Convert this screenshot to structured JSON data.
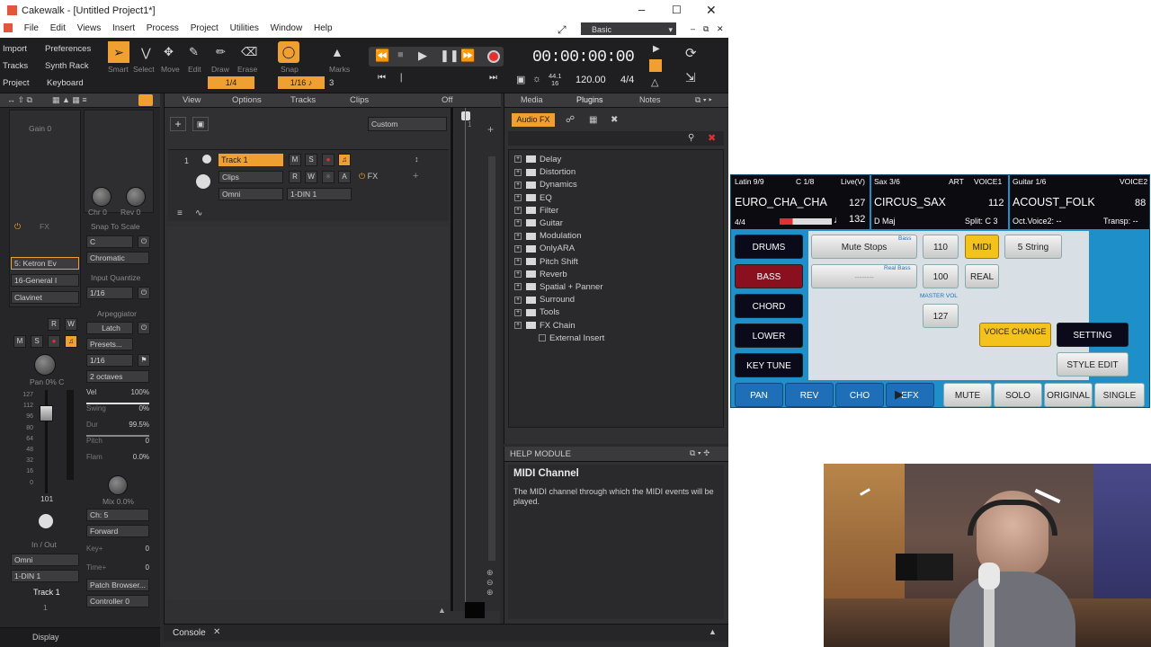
{
  "window": {
    "title": "Cakewalk - [Untitled Project1*]",
    "workspace": "Basic"
  },
  "menu": [
    "File",
    "Edit",
    "Views",
    "Insert",
    "Process",
    "Project",
    "Utilities",
    "Window",
    "Help"
  ],
  "quick": {
    "import": "Import",
    "preferences": "Preferences",
    "tracks": "Tracks",
    "synth_rack": "Synth Rack",
    "project": "Project",
    "keyboard": "Keyboard"
  },
  "tools": {
    "smart": "Smart",
    "select": "Select",
    "move": "Move",
    "edit": "Edit",
    "draw": "Draw",
    "erase": "Erase",
    "snap": "Snap",
    "marks": "Marks",
    "snap_value": "1/4",
    "grid_value": "1/16",
    "grid_num": "3"
  },
  "transport": {
    "time": "00:00:00:00",
    "sample_top": "44.1",
    "sample_bot": "16",
    "tempo": "120.00",
    "meter": "4/4"
  },
  "inspector": {
    "gain": "Gain",
    "gain_val": "0",
    "fx": "FX",
    "chr": "Chr",
    "chr_val": "0",
    "rev": "Rev",
    "rev_val": "0",
    "snap_to_scale": "Snap To Scale",
    "scale_root": "C",
    "scale_type": "Chromatic",
    "synth": "5: Ketron Ev",
    "program": "16-General I",
    "preset": "Clavinet",
    "input_quantize": "Input Quantize",
    "iq_val": "1/16",
    "arp": "Arpeggiator",
    "latch": "Latch",
    "presets": "Presets...",
    "arp_rate": "1/16",
    "octaves": "2 octaves",
    "vel": "Vel",
    "vel_val": "100%",
    "swing": "Swing",
    "swing_val": "0%",
    "dur": "Dur",
    "dur_val": "99.5%",
    "pitch": "Pitch",
    "pitch_val": "0",
    "flam": "Flam",
    "flam_val": "0.0%",
    "mix": "Mix",
    "mix_val": "0.0%",
    "channel": "Ch: 5",
    "direction": "Forward",
    "key": "Key+",
    "key_val": "0",
    "time": "Time+",
    "time_val": "0",
    "patch_browser": "Patch Browser...",
    "controller": "Controller 0",
    "pan": "Pan",
    "pan_val": "0% C",
    "vol_val": "101",
    "scale": [
      "127",
      "112",
      "96",
      "80",
      "64",
      "48",
      "32",
      "16",
      "0"
    ],
    "in_out": "In / Out",
    "input": "Omni",
    "output": "1-DIN 1",
    "track": "Track 1",
    "track_num": "1",
    "display": "Display",
    "m": "M",
    "s": "S",
    "r": "R",
    "w": "W"
  },
  "trackview": {
    "menus": [
      "View",
      "Options",
      "Tracks",
      "Clips",
      "Off"
    ],
    "custom": "Custom",
    "track_num": "1",
    "track_name": "Track 1",
    "clips": "Clips",
    "input": "Omni",
    "output": "1-DIN 1",
    "fx": "FX",
    "m": "M",
    "s": "S",
    "r": "R",
    "w": "W",
    "a": "A"
  },
  "browser": {
    "tabs": [
      "Media",
      "Plugins",
      "Notes"
    ],
    "audio_fx": "Audio FX",
    "items": [
      "Delay",
      "Distortion",
      "Dynamics",
      "EQ",
      "Filter",
      "Guitar",
      "Modulation",
      "OnlyARA",
      "Pitch Shift",
      "Reverb",
      "Spatial + Panner",
      "Surround",
      "Tools",
      "FX Chain",
      "External Insert"
    ]
  },
  "help": {
    "header": "HELP MODULE",
    "title": "MIDI Channel",
    "body": "The MIDI channel through which the MIDI events will be played."
  },
  "console": {
    "label": "Console"
  },
  "keyboard": {
    "slot1": {
      "top_l": "Latin 9/9",
      "top_m": "C 1/8",
      "top_r": "Live(V)",
      "name": "EURO_CHA_CHA",
      "num": "127",
      "sig": "4/4",
      "num2": "132"
    },
    "slot2": {
      "top_l": "Sax 3/6",
      "top_m": "ART",
      "top_r": "VOICE1",
      "name": "CIRCUS_SAX",
      "num": "112",
      "key": "D Maj",
      "split": "Split: C 3"
    },
    "slot3": {
      "top_l": "Guitar 1/6",
      "top_r": "VOICE2",
      "name": "ACOUST_FOLK",
      "num": "88",
      "oct": "Oct.Voice2: --",
      "transp": "Transp: --"
    },
    "left": [
      "DRUMS",
      "BASS",
      "CHORD",
      "LOWER",
      "KEY TUNE"
    ],
    "mute_stops": "Mute Stops",
    "bass_tag": "Bass",
    "real_bass": "Real Bass",
    "dashes": "--------",
    "v110": "110",
    "v100": "100",
    "master_vol": "MASTER VOL",
    "v127": "127",
    "midi": "MIDI",
    "real": "REAL",
    "five_string": "5 String",
    "voice_change": "VOICE CHANGE",
    "setting": "SETTING",
    "style_edit": "STYLE EDIT",
    "bottom": [
      "PAN",
      "REV",
      "CHO",
      "EFX",
      "MUTE",
      "SOLO",
      "ORIGINAL",
      "SINGLE"
    ]
  }
}
